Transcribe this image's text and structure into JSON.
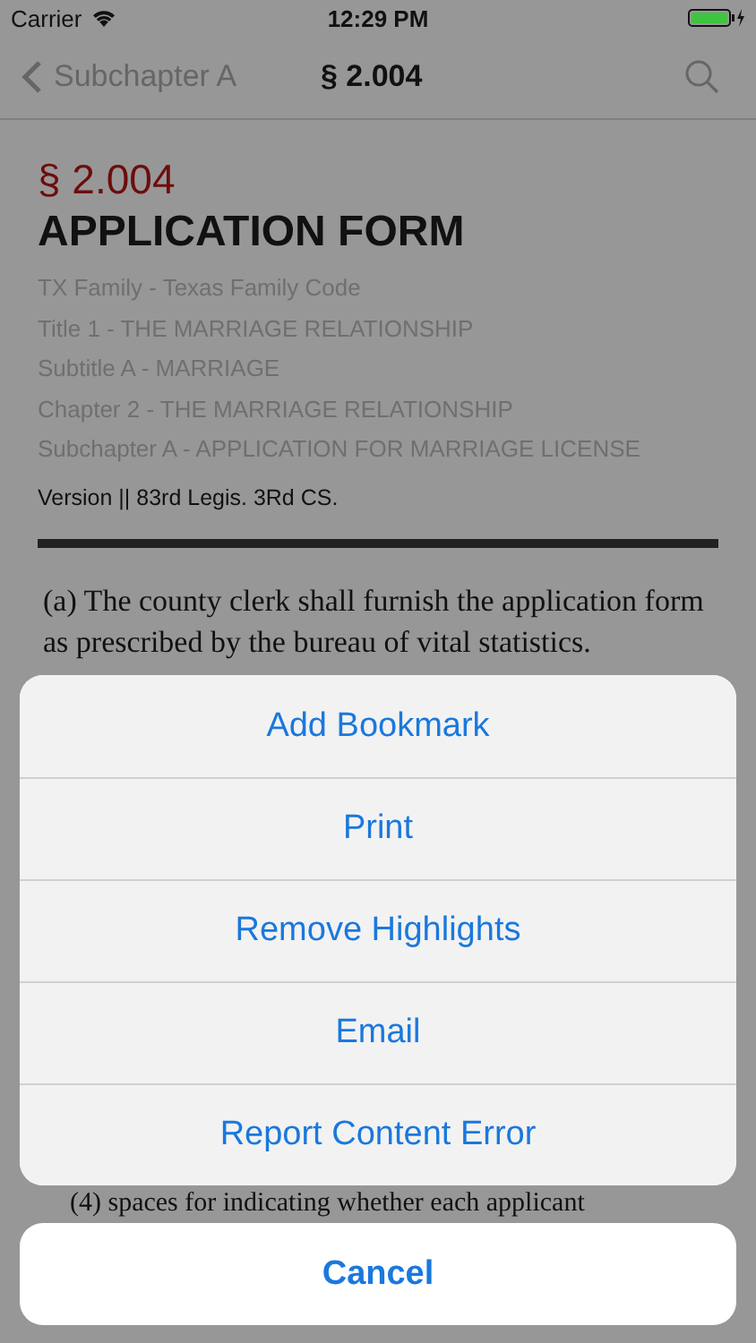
{
  "status_bar": {
    "carrier": "Carrier",
    "time": "12:29 PM"
  },
  "nav_bar": {
    "back_label": "Subchapter A",
    "title": "§ 2.004"
  },
  "section": {
    "number": "§ 2.004",
    "heading": "APPLICATION FORM",
    "breadcrumbs": [
      "TX Family - Texas Family Code",
      "Title 1 - THE MARRIAGE RELATIONSHIP",
      "Subtitle A - MARRIAGE",
      "Chapter 2 - THE MARRIAGE RELATIONSHIP",
      "Subchapter A - APPLICATION FOR MARRIAGE LICENSE"
    ],
    "version": "Version || 83rd Legis. 3Rd CS."
  },
  "body_text": [
    "(a) The county clerk shall furnish the application form as prescribed by the bureau of vital statistics."
  ],
  "trailing_text": "(4) spaces for indicating whether each applicant",
  "action_sheet": {
    "actions": [
      "Add Bookmark",
      "Print",
      "Remove Highlights",
      "Email",
      "Report Content Error"
    ],
    "cancel": "Cancel"
  }
}
